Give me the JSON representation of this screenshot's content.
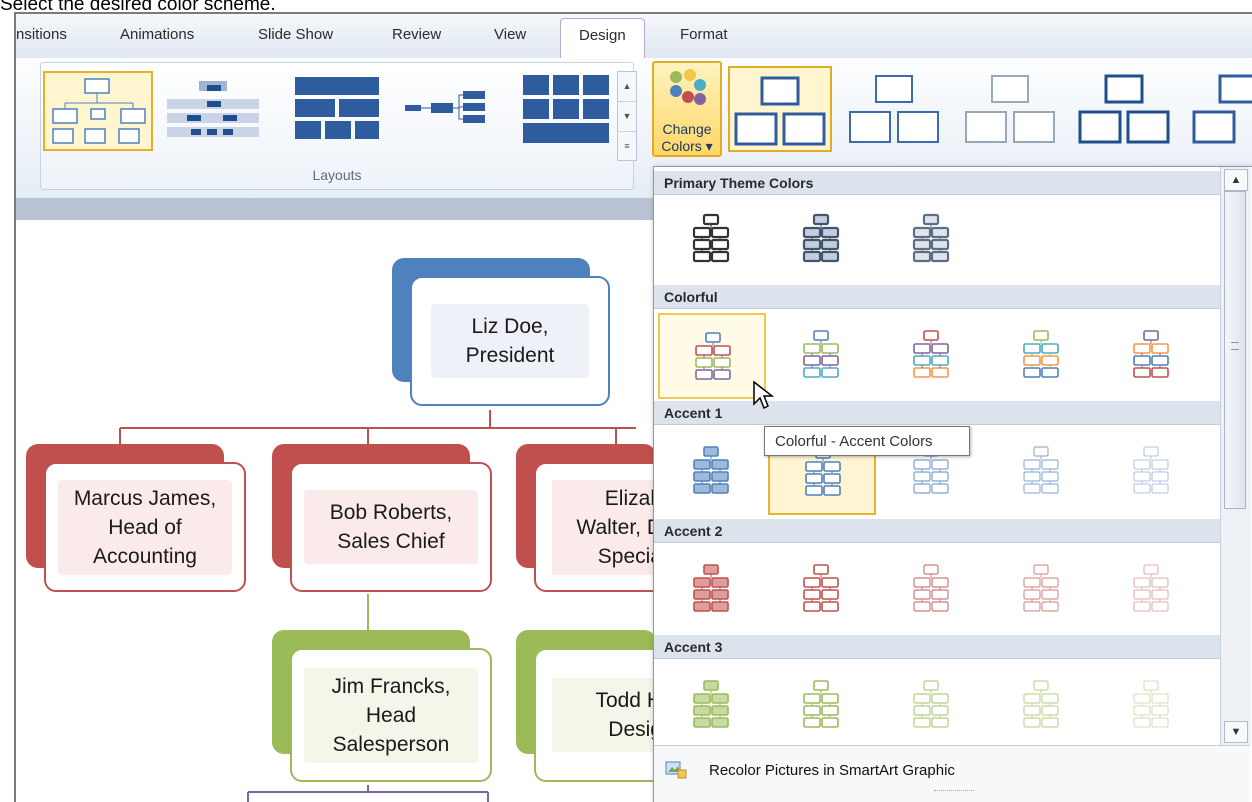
{
  "caption": "Select the desired color scheme.",
  "tabs": [
    {
      "label": "nsitions"
    },
    {
      "label": "Animations"
    },
    {
      "label": "Slide Show"
    },
    {
      "label": "Review"
    },
    {
      "label": "View"
    },
    {
      "label": "Design",
      "active": true
    },
    {
      "label": "Format"
    }
  ],
  "ribbon": {
    "layouts_label": "Layouts",
    "change_colors_label_line1": "Change",
    "change_colors_label_line2": "Colors ▾"
  },
  "colors": {
    "accent_blue": "#4f81bd",
    "accent_red": "#c0504d",
    "accent_green": "#9bbb59",
    "accent_purple": "#8064a2",
    "accent_aqua": "#4bacc6",
    "accent_orange": "#f79646",
    "ribbon_selected": "#e6b12a"
  },
  "gallery": {
    "sections": [
      {
        "label": "Primary Theme Colors",
        "options": [
          "Dark 1 Outline",
          "Dark 2 Outline",
          "Dark 2 Fill"
        ]
      },
      {
        "label": "Colorful",
        "options": [
          "Colorful - Accent Colors",
          "Colorful Range - Accent Colors 2 to 3",
          "Colorful Range - Accent Colors 3 to 4",
          "Colorful Range - Accent Colors 4 to 5",
          "Colorful Range - Accent Colors 5 to 6"
        ]
      },
      {
        "label": "Accent 1",
        "options": [
          "Colored Fill - Accent 1",
          "Colored Outline - Accent 1",
          "Gradient Range - Accent 1",
          "Gradient Loop - Accent 1",
          "Transparent Gradient Range - Accent 1"
        ]
      },
      {
        "label": "Accent 2",
        "options": [
          "Colored Fill - Accent 2",
          "Colored Outline - Accent 2",
          "Gradient Range - Accent 2",
          "Gradient Loop - Accent 2",
          "Transparent Gradient Range - Accent 2"
        ]
      },
      {
        "label": "Accent 3",
        "options": [
          "Colored Fill - Accent 3",
          "Colored Outline - Accent 3",
          "Gradient Range - Accent 3",
          "Gradient Loop - Accent 3",
          "Transparent Gradient Range - Accent 3"
        ]
      }
    ],
    "footer_label": "Recolor Pictures in SmartArt Graphic",
    "tooltip": "Colorful - Accent Colors"
  },
  "org_chart": {
    "top": "Liz Doe, President",
    "row2": [
      {
        "line1": "Marcus James,",
        "line2": "Head of",
        "line3": "Accounting"
      },
      {
        "line1": "Bob Roberts,",
        "line2": "Sales Chief",
        "line3": ""
      },
      {
        "line1": "Elizab",
        "line2": "Walter, D",
        "line3": "Specia"
      }
    ],
    "row3": [
      {
        "line1": "Jim Francks,",
        "line2": "Head",
        "line3": "Salesperson"
      },
      {
        "line1": "Todd H",
        "line2": "Desig",
        "line3": ""
      }
    ]
  }
}
